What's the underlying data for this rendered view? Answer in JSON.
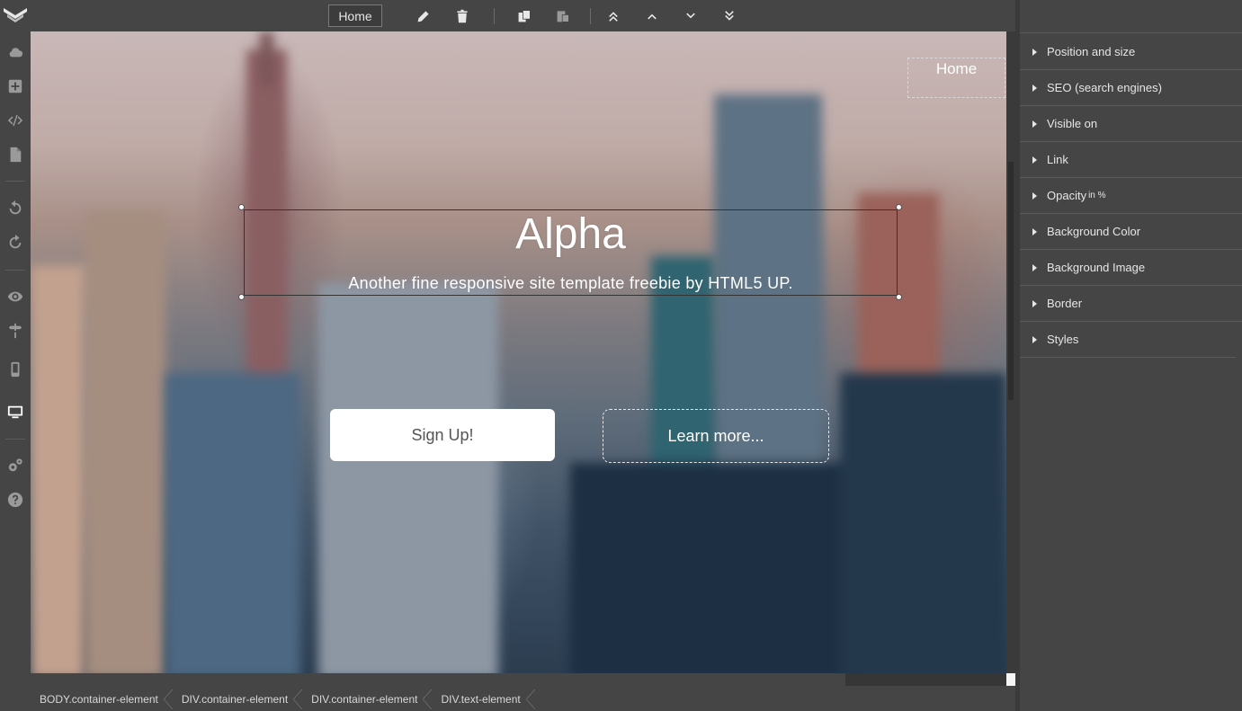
{
  "toolbar": {
    "page_select_value": "Home",
    "icons": [
      "pencil-icon",
      "trash-icon",
      "copy-icon",
      "paste-icon",
      "move-top-icon",
      "move-up-icon",
      "move-down-icon",
      "move-bottom-icon"
    ]
  },
  "sidebar": {
    "icons": [
      "cloud-icon",
      "add-icon",
      "code-icon",
      "file-icon",
      "undo-icon",
      "redo-icon",
      "preview-icon",
      "route-icon",
      "mobile-icon",
      "desktop-icon",
      "settings-icon",
      "help-icon"
    ]
  },
  "canvas": {
    "nav_home": "Home",
    "hero_title": "Alpha",
    "hero_subtitle": "Another fine responsive site template freebie by HTML5 UP.",
    "btn_signup": "Sign Up!",
    "btn_learn": "Learn more..."
  },
  "breadcrumb": [
    "BODY.container-element",
    "DIV.container-element",
    "DIV.container-element",
    "DIV.text-element"
  ],
  "panel": {
    "items": [
      {
        "label": "Position and size",
        "suffix": ""
      },
      {
        "label": "SEO (search engines)",
        "suffix": ""
      },
      {
        "label": "Visible on",
        "suffix": ""
      },
      {
        "label": "Link",
        "suffix": ""
      },
      {
        "label": "Opacity",
        "suffix": "in %"
      },
      {
        "label": "Background Color",
        "suffix": ""
      },
      {
        "label": "Background Image",
        "suffix": ""
      },
      {
        "label": "Border",
        "suffix": ""
      },
      {
        "label": "Styles",
        "suffix": ""
      }
    ]
  }
}
